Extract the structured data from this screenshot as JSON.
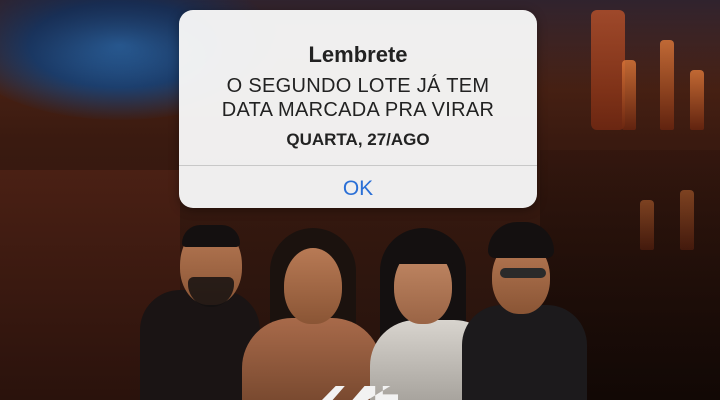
{
  "alert": {
    "title": "Lembrete",
    "message_line1": "O SEGUNDO LOTE JÁ TEM",
    "message_line2": "DATA MARCADA PRA VIRAR",
    "date": "QUARTA, 27/AGO",
    "ok_label": "OK",
    "ok_color": "#2a6fd6"
  },
  "background": {
    "scene": "bar-interior",
    "people_count": 4
  }
}
